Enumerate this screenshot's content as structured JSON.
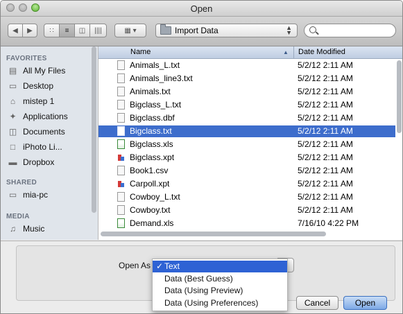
{
  "window": {
    "title": "Open"
  },
  "toolbar": {
    "back_icon": "back-icon",
    "forward_icon": "forward-icon",
    "view_modes": [
      "icon-view",
      "list-view",
      "column-view",
      "coverflow-view"
    ],
    "arrange_icon": "arrange-icon",
    "location": "Import Data",
    "search_placeholder": ""
  },
  "sidebar": {
    "favorites_header": "FAVORITES",
    "favorites": [
      {
        "label": "All My Files",
        "icon": "all-files-icon"
      },
      {
        "label": "Desktop",
        "icon": "desktop-icon"
      },
      {
        "label": "mistep 1",
        "icon": "home-icon"
      },
      {
        "label": "Applications",
        "icon": "applications-icon"
      },
      {
        "label": "Documents",
        "icon": "documents-icon"
      },
      {
        "label": "iPhoto Li...",
        "icon": "file-icon"
      },
      {
        "label": "Dropbox",
        "icon": "folder-icon"
      }
    ],
    "shared_header": "SHARED",
    "shared": [
      {
        "label": "mia-pc",
        "icon": "computer-icon"
      }
    ],
    "media_header": "MEDIA",
    "media": [
      {
        "label": "Music",
        "icon": "music-icon"
      }
    ]
  },
  "files": {
    "col_name": "Name",
    "col_date": "Date Modified",
    "rows": [
      {
        "name": "Animals_L.txt",
        "date": "5/2/12 2:11 AM",
        "type": "txt"
      },
      {
        "name": "Animals_line3.txt",
        "date": "5/2/12 2:11 AM",
        "type": "txt"
      },
      {
        "name": "Animals.txt",
        "date": "5/2/12 2:11 AM",
        "type": "txt"
      },
      {
        "name": "Bigclass_L.txt",
        "date": "5/2/12 2:11 AM",
        "type": "txt"
      },
      {
        "name": "Bigclass.dbf",
        "date": "5/2/12 2:11 AM",
        "type": "dbf"
      },
      {
        "name": "Bigclass.txt",
        "date": "5/2/12 2:11 AM",
        "type": "txt",
        "selected": true
      },
      {
        "name": "Bigclass.xls",
        "date": "5/2/12 2:11 AM",
        "type": "xls"
      },
      {
        "name": "Bigclass.xpt",
        "date": "5/2/12 2:11 AM",
        "type": "xpt"
      },
      {
        "name": "Book1.csv",
        "date": "5/2/12 2:11 AM",
        "type": "csv"
      },
      {
        "name": "Carpoll.xpt",
        "date": "5/2/12 2:11 AM",
        "type": "xpt"
      },
      {
        "name": "Cowboy_L.txt",
        "date": "5/2/12 2:11 AM",
        "type": "txt"
      },
      {
        "name": "Cowboy.txt",
        "date": "5/2/12 2:11 AM",
        "type": "txt"
      },
      {
        "name": "Demand.xls",
        "date": "7/16/10 4:22 PM",
        "type": "xls"
      }
    ]
  },
  "options": {
    "open_as_label": "Open As",
    "menu": [
      {
        "label": "Text",
        "checked": true,
        "highlighted": true
      },
      {
        "label": "Data (Best Guess)"
      },
      {
        "label": "Data (Using Preview)"
      },
      {
        "label": "Data (Using Preferences)"
      }
    ]
  },
  "buttons": {
    "cancel": "Cancel",
    "open": "Open"
  },
  "colors": {
    "selection": "#3d6dcc",
    "menu_highlight": "#2e62d4",
    "sidebar_bg": "#e0e5eb"
  }
}
